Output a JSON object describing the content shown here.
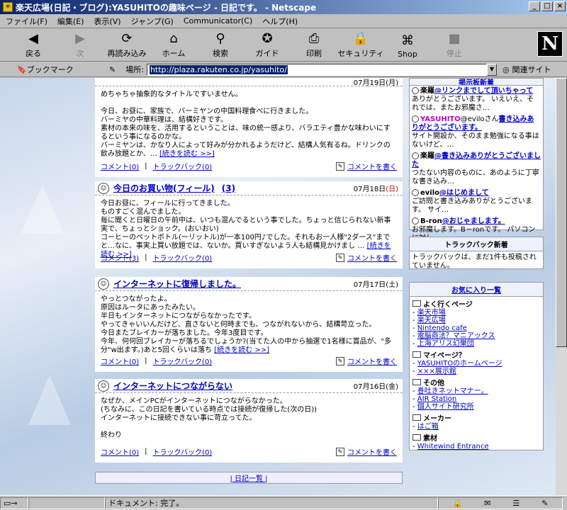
{
  "window": {
    "title": "楽天広場(日記・ブログ):YASUHITOの趣味ページ - 日記です。 - Netscape"
  },
  "menu": [
    "ファイル(F)",
    "編集(E)",
    "表示(V)",
    "ジャンプ(G)",
    "Communicator(C)",
    "ヘルプ(H)"
  ],
  "toolbar": [
    {
      "label": "戻る",
      "icon": "back-arrow-icon",
      "glyph": "◀",
      "enabled": true
    },
    {
      "label": "次",
      "icon": "forward-arrow-icon",
      "glyph": "▶",
      "enabled": false
    },
    {
      "label": "再読み込み",
      "icon": "reload-icon",
      "glyph": "⟳",
      "enabled": true
    },
    {
      "label": "ホーム",
      "icon": "home-icon",
      "glyph": "⌂",
      "enabled": true
    },
    {
      "label": "検索",
      "icon": "search-icon",
      "glyph": "⚲",
      "enabled": true
    },
    {
      "label": "ガイド",
      "icon": "guide-icon",
      "glyph": "✪",
      "enabled": true
    },
    {
      "label": "印刷",
      "icon": "print-icon",
      "glyph": "⎙",
      "enabled": true
    },
    {
      "label": "セキュリティ",
      "icon": "security-lock-icon",
      "glyph": "🔒",
      "enabled": true
    },
    {
      "label": "Shop",
      "icon": "shop-icon",
      "glyph": "⌘",
      "enabled": true
    },
    {
      "label": "停止",
      "icon": "stop-icon",
      "glyph": "■",
      "enabled": false
    }
  ],
  "location": {
    "bookmark_label": "ブックマーク",
    "location_label": "場所:",
    "url": "http://plaza.rakuten.co.jp/yasuhito/",
    "related_label": "関連サイト"
  },
  "entries": [
    {
      "title": "",
      "date": "07月19日(月)",
      "body": "めちゃちゃ抽象的なタイトルですいません。\n\n今日、お昼に、家族で、バーミヤンの中国料理食べに行きました。\nバーミヤの中華料理は、結構好きです。\n素材の本来の味を、活用するということは、味の統一感より、バラエティ豊かな味わいにするという事になるのかな。\nバーミヤンは、かなり人によって好みが分かれるようだけど、結構人気有るね。ドリンクの飲み放題とか、…",
      "more": "[続きを読む >>]",
      "comment": "コメント(0)",
      "trackback": "トラックバック(0)",
      "write": "コメントを書く"
    },
    {
      "title": "今日のお買い物(フィール)",
      "count": "(3)",
      "date": "07月18日",
      "weekday": "(日)",
      "body": "今日お昼に、フィールに行ってきました。\nものすごく混んでました。\n毎に聞くと日曜日の午前中は、いつも混んでるという事でした。ちょっと信じられない新事実で、ちょっとショック。(おいおい)\nコーヒーのペットボトル(ーリットル)が一本100円♪でした。それもお一人様\"2ダース\"までと…なに、事実上買い放題では、ないか。買いすぎないよう人も結構見かけまし …",
      "more": "[続きを読む >>]",
      "comment": "コメント(3)",
      "trackback": "トラックバック(0)",
      "write": "コメントを書く"
    },
    {
      "title": "インターネットに復帰しました。",
      "date": "07月17日",
      "weekday": "(土)",
      "body": "やっとつながったよ。\n原因はルータにあったみたい。\n半日もインターネットにつながらなかったです。\nやってきゃいいんだけど、直さないと何時までも、つながれないから、結構苛立った。\n今日またブレイカーが落ちました。今年3度目です。\n今年、何何回ブレイカーが落ちるでしょうか?(当てた人の中から抽選で1名様に賞品が、\"多分\"w出ます。)あと5回くらいは落ち",
      "more": "[続きを読む >>]",
      "comment": "コメント(0)",
      "trackback": "トラックバック(0)",
      "write": "コメントを書く"
    },
    {
      "title": "インターネットにつながらない",
      "date": "07月16日(金)",
      "body": "なぜか、メインPCがインターネットにつながらなかった。\n(ちなみに、この日記を書いている時点では接続が復帰した(次の日))\nインターネットに接続できない事に苛立ってた。\n\n終わり",
      "comment": "コメント(0)",
      "trackback": "トラックバック(0)",
      "write": "コメントを書く"
    }
  ],
  "archive_label": "| 日記一覧 |",
  "sidebar": {
    "comments_header": "掲示板新着",
    "comments": [
      {
        "who": "楽羅",
        "link": "@リンクまでして頂いちゃって",
        "text": "ありがとうございます。 いえいえ、それでは、またお邪魔さ…"
      },
      {
        "who": "YASUHITO",
        "mid": "@eviloさん",
        "link": "書き込みありがとうございます。",
        "text": "サイト開設か、そのまま勉強になる事はないけど、…"
      },
      {
        "who": "楽羅",
        "link": "@書き込みありがとうございました",
        "text": "つたない内容のものに、あのように丁寧な書き込み…"
      },
      {
        "who": "evilo",
        "link": "@はじめまして",
        "text": "ご訪問と書き込みありがとうございます。 サイ…"
      },
      {
        "who": "B-ron",
        "link": "@おじゃまします。",
        "text": "お邪魔します。B－ronです。 パソコンに対し…"
      }
    ],
    "trackback_header": "トラックバック新着",
    "trackback_text": "トラックバックは、まだ1件も投稿されていません。",
    "favorites_header": "お気に入り一覧",
    "favorites": [
      {
        "category": "よく行くページ",
        "links": [
          "楽天市場",
          "楽天広場",
          "Nintendo cafe",
          "電脳商法？マニアックス",
          "上海アリス幻樂団"
        ]
      },
      {
        "category": "マイページ？",
        "links": [
          "YASUHITOのホームページ",
          "×××展示館"
        ]
      },
      {
        "category": "その他",
        "links": [
          "巻吐きネットマナー。",
          "AIR Station",
          "個人サイト研究所"
        ]
      },
      {
        "category": "メーカー",
        "links": [
          "はご箱"
        ]
      },
      {
        "category": "素材",
        "links": [
          "Whitewind Entrance"
        ]
      }
    ]
  },
  "status": {
    "text": "ドキュメント: 完了。"
  },
  "colors": {
    "titlebar": "#0a246a",
    "link": "#0000cc",
    "sunday": "#cc0000"
  }
}
